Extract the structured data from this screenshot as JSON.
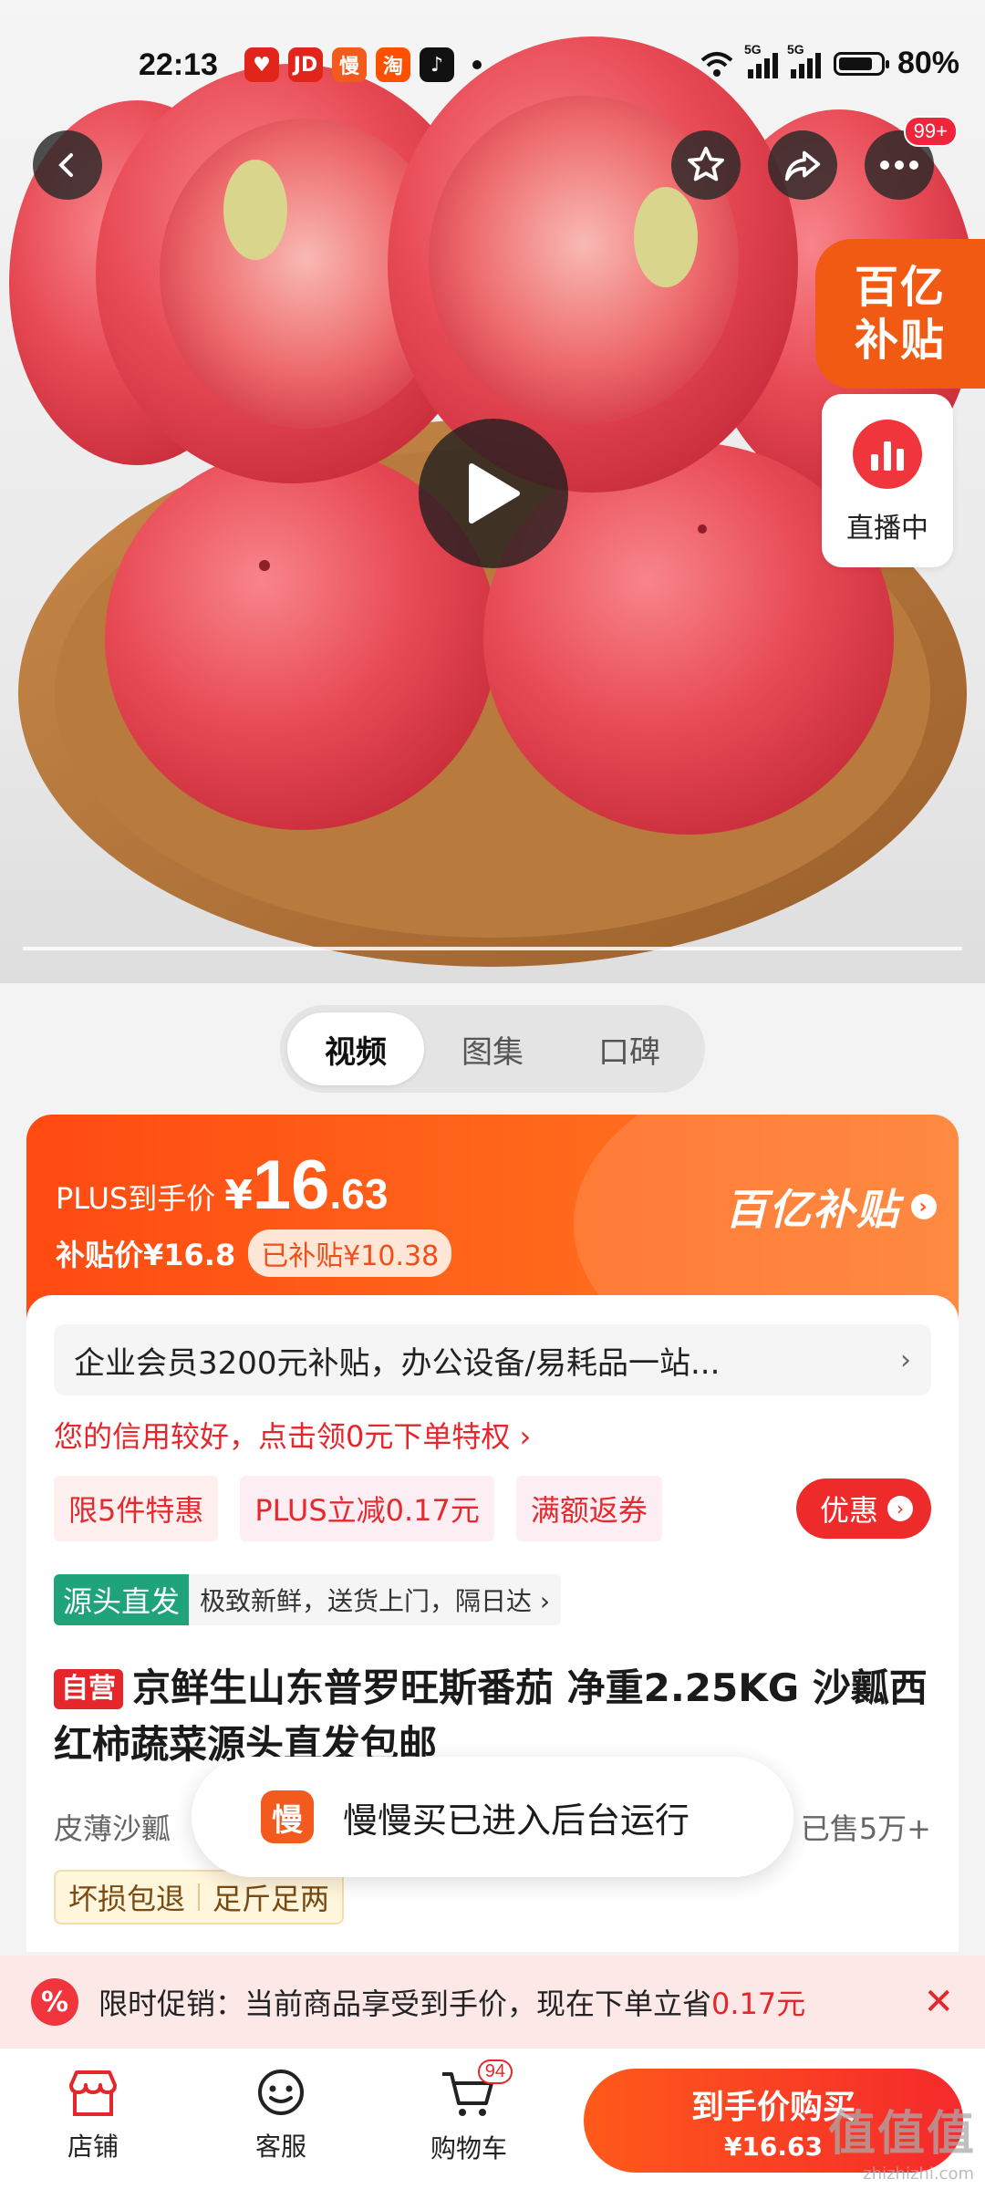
{
  "status_bar": {
    "time": "22:13",
    "app_icons": [
      {
        "name": "jd-red-icon",
        "glyph": "♥",
        "color": "#e1251b"
      },
      {
        "name": "jd-icon",
        "glyph": "JD",
        "color": "#e1251b"
      },
      {
        "name": "manmanmai-icon",
        "glyph": "慢",
        "color": "#f25a1e"
      },
      {
        "name": "taobao-icon",
        "glyph": "淘",
        "color": "#ff5000"
      },
      {
        "name": "tiktok-icon",
        "glyph": "♪",
        "color": "#111111"
      }
    ],
    "network1": "5G",
    "network2": "5G",
    "battery": "80%"
  },
  "header": {
    "more_badge": "99+"
  },
  "hero": {
    "subsidy_line1": "百亿",
    "subsidy_line2": "补贴",
    "live_label": "直播中",
    "progress": 0.0
  },
  "media_tabs": [
    "视频",
    "图集",
    "口碑"
  ],
  "price": {
    "plus_label": "PLUS到手价",
    "currency": "¥",
    "int_part": "16",
    "dec_part": ".63",
    "subsidy_price": "补贴价¥16.8",
    "subsidized_chip": "已补贴¥10.38",
    "brand": "百亿补贴"
  },
  "info": {
    "enterprise": "企业会员3200元补贴，办公设备/易耗品一站...",
    "credit": "您的信用较好，点击领0元下单特权 ›",
    "promos": [
      "限5件特惠",
      "PLUS立减0.17元",
      "满额返券"
    ],
    "youhui": "优惠",
    "source_tag": "源头直发",
    "source_desc": "极致新鲜，送货上门，隔日达 ›",
    "self_tag": "自营",
    "title": "京鲜生山东普罗旺斯番茄 净重2.25KG 沙瓤西红柿蔬菜源头直发包邮",
    "attr": "皮薄沙瓤",
    "sold": "已售5万+",
    "assure": [
      "坏损包退",
      "足斤足两"
    ]
  },
  "toast": {
    "icon": "慢",
    "message": "慢慢买已进入后台运行"
  },
  "promo_bar": {
    "icon": "%",
    "prefix": "限时促销：当前商品享受到手价，现在下单立省",
    "amount": "0.17元",
    "close": "✕"
  },
  "bottom": {
    "shop": "店铺",
    "service": "客服",
    "cart": "购物车",
    "cart_count": "94",
    "buy_line1": "到手价购买",
    "buy_line2": "¥16.63"
  },
  "watermark": {
    "logo": "值值值",
    "url": "zhizhizhi.com"
  }
}
